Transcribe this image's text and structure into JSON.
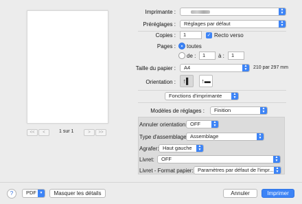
{
  "preview": {
    "page_counter": "1 sur 1",
    "nav": [
      "<<",
      "<",
      ">",
      ">>"
    ]
  },
  "printer": {
    "label": "Imprimante :",
    "value": ""
  },
  "presets": {
    "label": "Préréglages :",
    "value": "Réglages par défaut"
  },
  "copies": {
    "label": "Copies :",
    "value": "1",
    "duplex_label": "Recto verso",
    "duplex_checked": true
  },
  "pages": {
    "label": "Pages :",
    "all_label": "toutes",
    "from_label": "de :",
    "from_value": "1",
    "to_label": "à :",
    "to_value": "1"
  },
  "paper": {
    "label": "Taille du papier :",
    "value": "A4",
    "dimensions": "210 par 297 mm"
  },
  "orientation": {
    "label": "Orientation :",
    "portrait_icon": "portrait-orientation-icon",
    "landscape_icon": "landscape-orientation-icon",
    "selected": "portrait"
  },
  "section": {
    "value": "Fonctions d'imprimante"
  },
  "feature_sets": {
    "label": "Modèles de réglages :",
    "value": "Finition"
  },
  "finishing": {
    "cancel_orientation": {
      "label": "Annuler orientation:",
      "value": "OFF"
    },
    "assembly_type": {
      "label": "Type d'assemblage:",
      "value": "Assemblage"
    },
    "staple": {
      "label": "Agrafer:",
      "value": "Haut gauche"
    },
    "booklet": {
      "label": "Livret:",
      "value": "OFF"
    },
    "booklet_paper": {
      "label": "Livret - Format papier:",
      "value": "Paramètres par défaut de l'impr..."
    }
  },
  "footer": {
    "help": "?",
    "pdf": "PDF",
    "hide_details": "Masquer les détails",
    "cancel": "Annuler",
    "print": "Imprimer"
  },
  "colors": {
    "accent": "#3d84f6",
    "background": "#ececec"
  }
}
